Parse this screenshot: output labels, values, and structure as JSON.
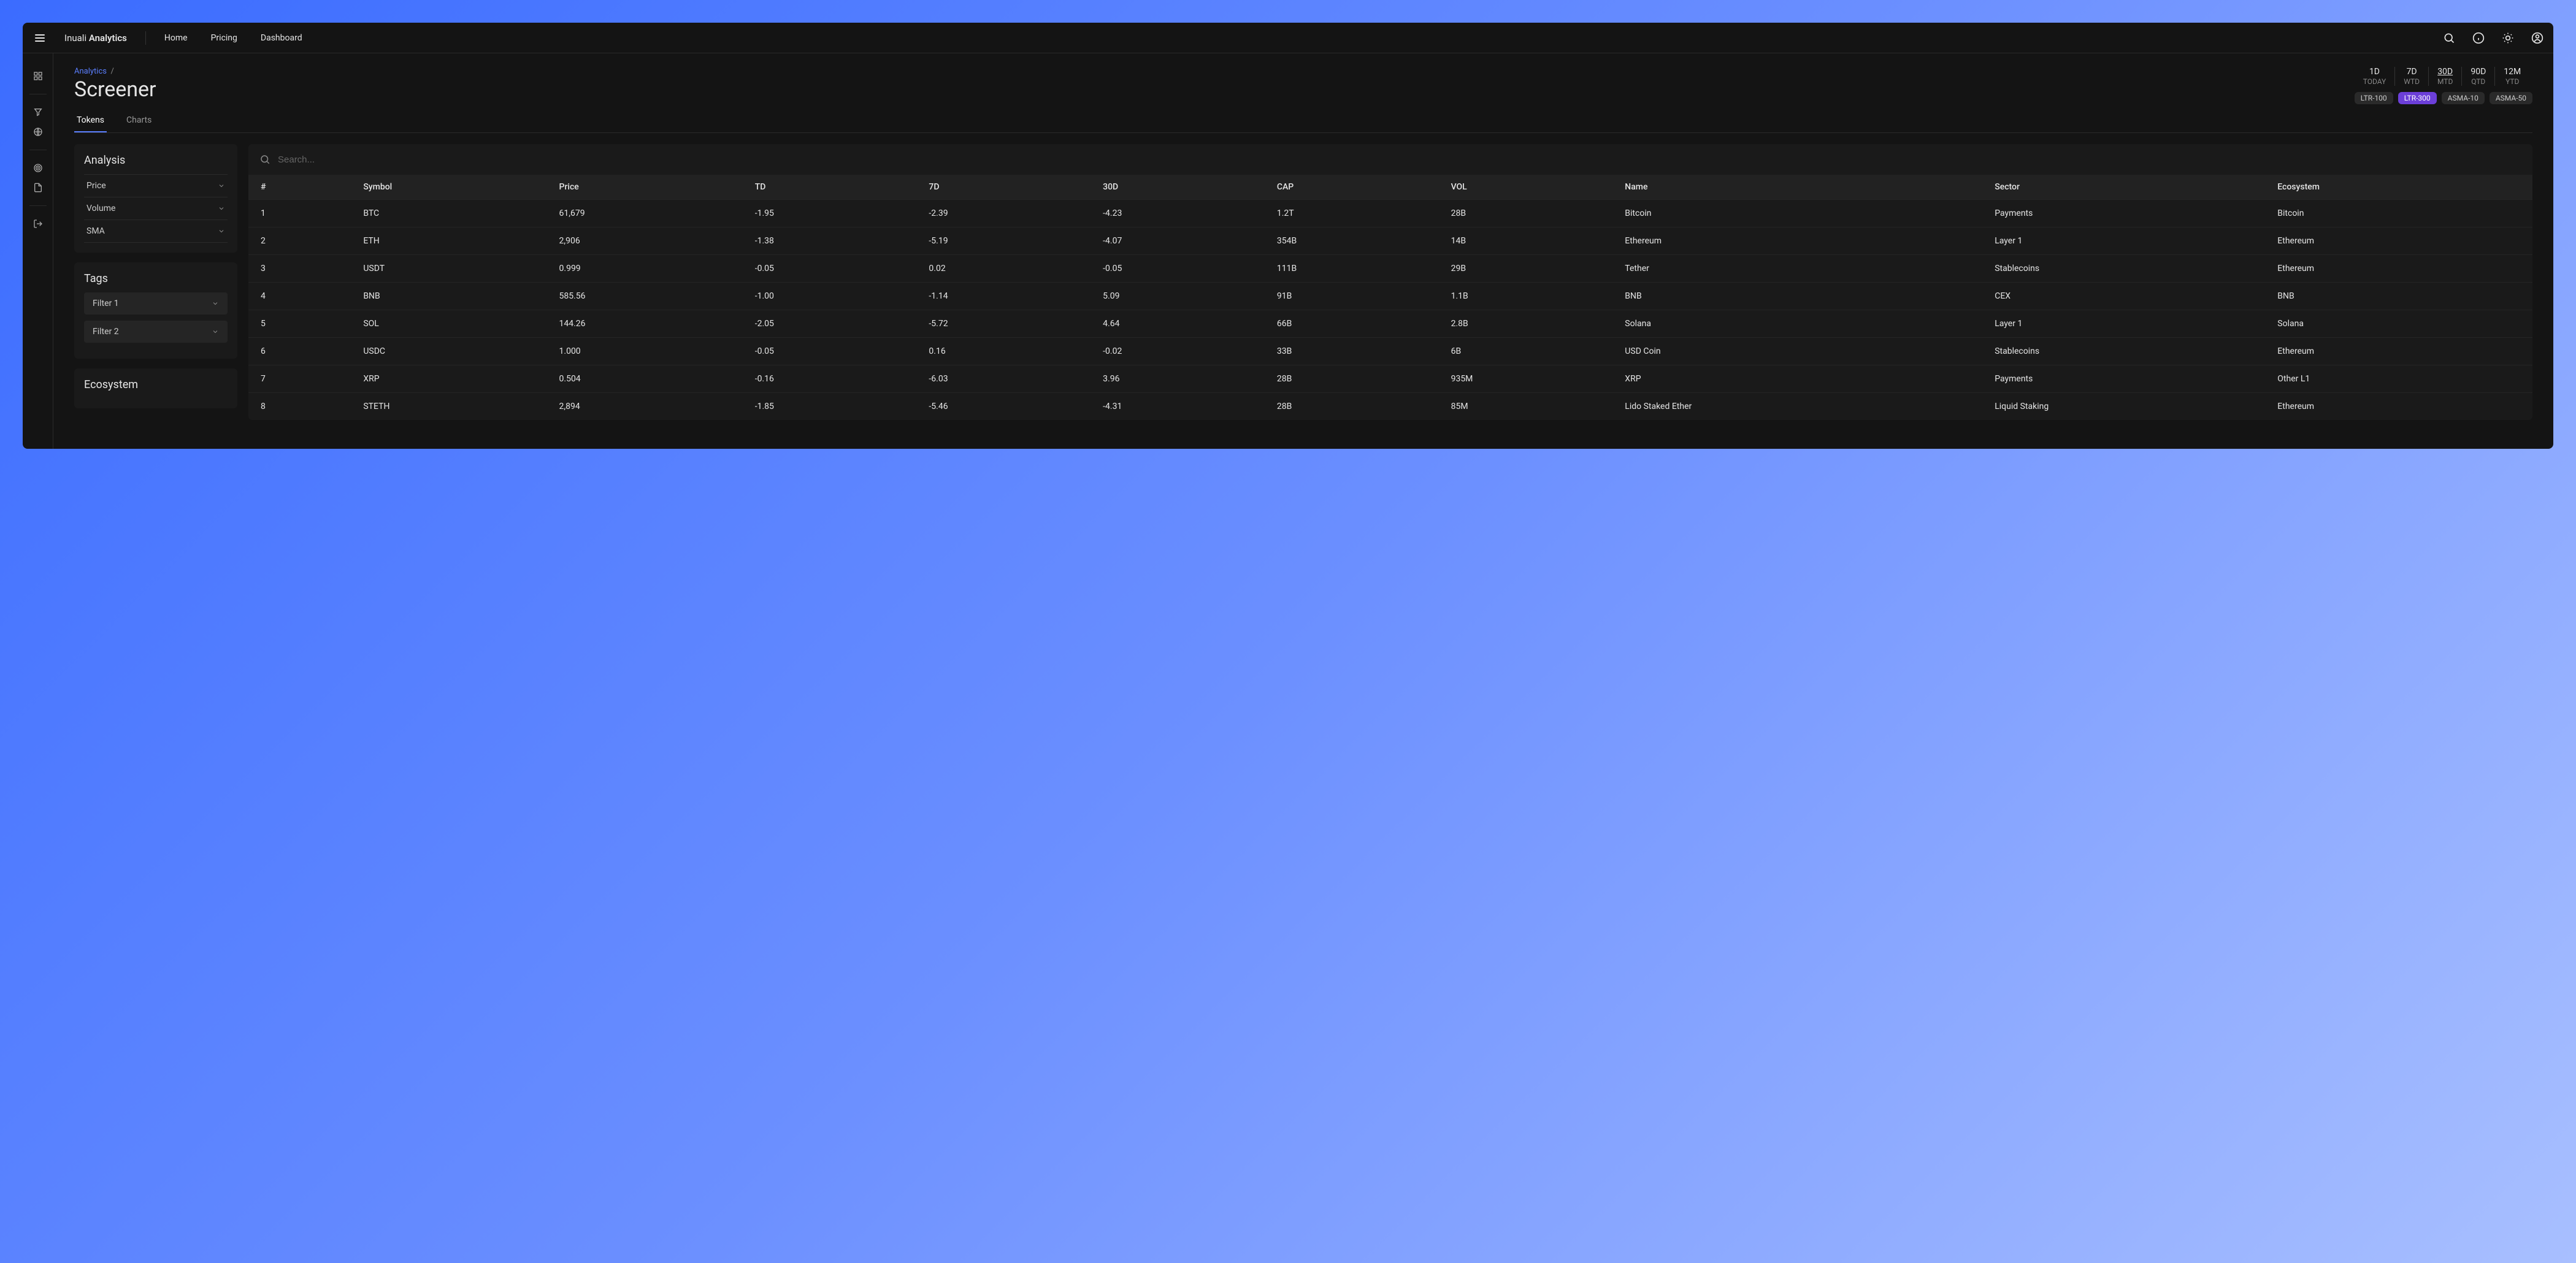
{
  "brand": {
    "prefix": "Inuali ",
    "strong": "Analytics"
  },
  "nav": [
    "Home",
    "Pricing",
    "Dashboard"
  ],
  "breadcrumb": {
    "parent": "Analytics",
    "sep": "/"
  },
  "page_title": "Screener",
  "periods": [
    {
      "top": "1D",
      "sub": "TODAY",
      "active": false
    },
    {
      "top": "7D",
      "sub": "WTD",
      "active": false
    },
    {
      "top": "30D",
      "sub": "MTD",
      "active": true
    },
    {
      "top": "90D",
      "sub": "QTD",
      "active": false
    },
    {
      "top": "12M",
      "sub": "YTD",
      "active": false
    }
  ],
  "chips": [
    {
      "label": "LTR-100",
      "active": false
    },
    {
      "label": "LTR-300",
      "active": true
    },
    {
      "label": "ASMA-10",
      "active": false
    },
    {
      "label": "ASMA-50",
      "active": false
    }
  ],
  "tabs": [
    {
      "label": "Tokens",
      "active": true
    },
    {
      "label": "Charts",
      "active": false
    }
  ],
  "analysis": {
    "title": "Analysis",
    "items": [
      "Price",
      "Volume",
      "SMA"
    ]
  },
  "tags": {
    "title": "Tags",
    "filters": [
      "Filter 1",
      "Filter 2"
    ]
  },
  "ecosystem": {
    "title": "Ecosystem"
  },
  "search": {
    "placeholder": "Search..."
  },
  "columns": [
    "#",
    "Symbol",
    "Price",
    "TD",
    "7D",
    "30D",
    "CAP",
    "VOL",
    "Name",
    "Sector",
    "Ecosystem"
  ],
  "rows": [
    {
      "idx": "1",
      "sym": "BTC",
      "price": "61,679",
      "td": "-1.95",
      "d7": "-2.39",
      "d30": "-4.23",
      "cap": "1.2T",
      "vol": "28B",
      "name": "Bitcoin",
      "sector": "Payments",
      "eco": "Bitcoin"
    },
    {
      "idx": "2",
      "sym": "ETH",
      "price": "2,906",
      "td": "-1.38",
      "d7": "-5.19",
      "d30": "-4.07",
      "cap": "354B",
      "vol": "14B",
      "name": "Ethereum",
      "sector": "Layer 1",
      "eco": "Ethereum"
    },
    {
      "idx": "3",
      "sym": "USDT",
      "price": "0.999",
      "td": "-0.05",
      "d7": "0.02",
      "d30": "-0.05",
      "cap": "111B",
      "vol": "29B",
      "name": "Tether",
      "sector": "Stablecoins",
      "eco": "Ethereum"
    },
    {
      "idx": "4",
      "sym": "BNB",
      "price": "585.56",
      "td": "-1.00",
      "d7": "-1.14",
      "d30": "5.09",
      "cap": "91B",
      "vol": "1.1B",
      "name": "BNB",
      "sector": "CEX",
      "eco": "BNB"
    },
    {
      "idx": "5",
      "sym": "SOL",
      "price": "144.26",
      "td": "-2.05",
      "d7": "-5.72",
      "d30": "4.64",
      "cap": "66B",
      "vol": "2.8B",
      "name": "Solana",
      "sector": "Layer 1",
      "eco": "Solana"
    },
    {
      "idx": "6",
      "sym": "USDC",
      "price": "1.000",
      "td": "-0.05",
      "d7": "0.16",
      "d30": "-0.02",
      "cap": "33B",
      "vol": "6B",
      "name": "USD Coin",
      "sector": "Stablecoins",
      "eco": "Ethereum"
    },
    {
      "idx": "7",
      "sym": "XRP",
      "price": "0.504",
      "td": "-0.16",
      "d7": "-6.03",
      "d30": "3.96",
      "cap": "28B",
      "vol": "935M",
      "name": "XRP",
      "sector": "Payments",
      "eco": "Other L1"
    },
    {
      "idx": "8",
      "sym": "STETH",
      "price": "2,894",
      "td": "-1.85",
      "d7": "-5.46",
      "d30": "-4.31",
      "cap": "28B",
      "vol": "85M",
      "name": "Lido Staked Ether",
      "sector": "Liquid Staking",
      "eco": "Ethereum"
    }
  ]
}
